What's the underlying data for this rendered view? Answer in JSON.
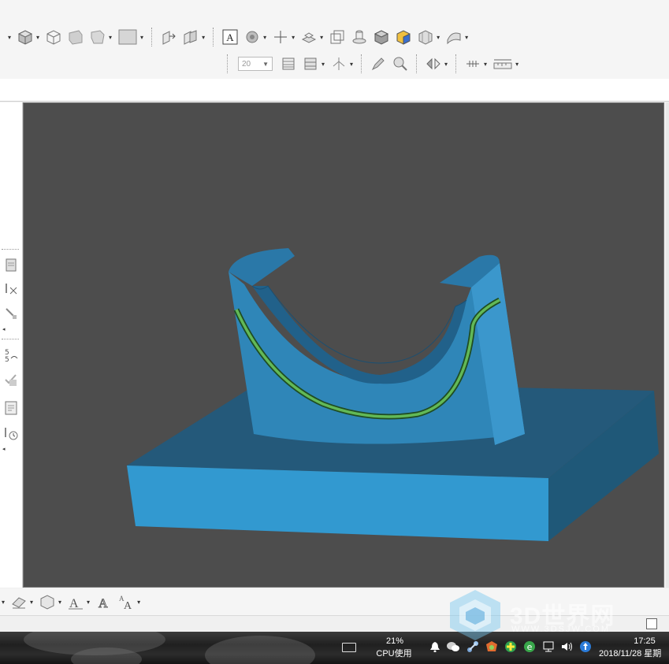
{
  "toolbar": {
    "zoom_value": "20"
  },
  "viewport": {
    "background": "#4d4d4d",
    "model_color": "#2f86b8",
    "edge_highlight": "#4caf50"
  },
  "status": {
    "cpu_percent": "21%",
    "cpu_label": "CPU使用",
    "time": "17:25",
    "date": "2018/11/28 星期"
  },
  "watermark": {
    "title": "3D世界网",
    "subtitle": "WWW.3DSJW.COM"
  },
  "icons": {
    "top_row": [
      "solid-box-icon",
      "wireframe-box-icon",
      "flat-shade-icon",
      "hidden-line-icon",
      "view-rect-icon",
      "extrude-icon",
      "boolean-icon",
      "text-icon",
      "tool-path-icon",
      "axis-cross-icon",
      "layer-stack-icon",
      "cube-outline-icon",
      "cylinder-icon",
      "shaded-cube-icon",
      "material-cube-icon",
      "mesh-icon",
      "surface-icon"
    ],
    "second_row": [
      "slice-icon",
      "layers-icon",
      "tree-icon",
      "pen-icon",
      "magnet-icon",
      "mirror-icon",
      "grid-icon",
      "ruler-icon"
    ]
  }
}
